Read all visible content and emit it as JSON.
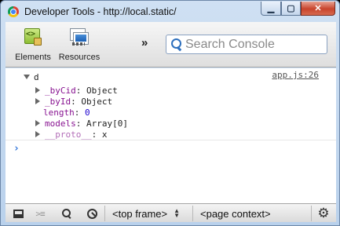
{
  "window": {
    "title": "Developer Tools - http://local.static/",
    "controls": {
      "minimize": "▁",
      "maximize": "▢",
      "close": "✕"
    }
  },
  "toolbar": {
    "tabs": [
      {
        "label": "Elements",
        "icon": "elements-icon"
      },
      {
        "label": "Resources",
        "icon": "resources-icon"
      }
    ],
    "overflow_label": "»",
    "search_placeholder": "Search Console"
  },
  "console": {
    "entry": {
      "root_name": "d",
      "source_link": "app.js:26",
      "properties": [
        {
          "key": "_byCid",
          "sep": ": ",
          "value": "Object",
          "expandable": true,
          "value_type": "object"
        },
        {
          "key": "_byId",
          "sep": ": ",
          "value": "Object",
          "expandable": true,
          "value_type": "object"
        },
        {
          "key": "length",
          "sep": ": ",
          "value": "0",
          "expandable": false,
          "value_type": "number"
        },
        {
          "key": "models",
          "sep": ": ",
          "value": "Array[0]",
          "expandable": true,
          "value_type": "object"
        },
        {
          "key": "__proto__",
          "sep": ": ",
          "value": "x",
          "expandable": true,
          "value_type": "object"
        }
      ]
    },
    "prompt": "›"
  },
  "statusbar": {
    "frame_select": "<top frame>",
    "context_select": "<page context>",
    "drawer_glyph": ">≡",
    "gear": "⚙"
  },
  "colors": {
    "property_key": "#881391",
    "number": "#1c00cf",
    "prompt": "#2d72d9"
  }
}
